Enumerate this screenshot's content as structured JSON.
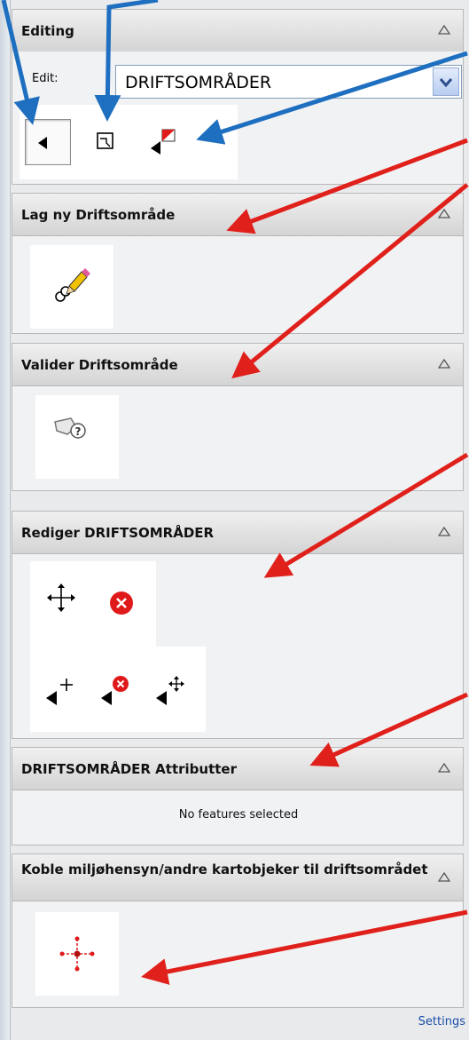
{
  "panel": {
    "title": "Editing",
    "edit_label": "Edit:",
    "layer_select": {
      "value": "DRIFTSOMRÅDER"
    },
    "edit_tools": [
      "select-tool-icon",
      "select-polygon-icon",
      "flag-select-icon"
    ]
  },
  "sections": {
    "create": {
      "title": "Lag ny Driftsområde",
      "tools": [
        "create-polygon-pencil-icon"
      ]
    },
    "validate": {
      "title": "Valider Driftsområde",
      "tools": [
        "validate-query-icon"
      ]
    },
    "edit": {
      "title": "Rediger DRIFTSOMRÅDER",
      "tools": [
        "move-icon",
        "delete-icon",
        "add-vertex-icon",
        "delete-vertex-icon",
        "move-vertex-icon"
      ]
    },
    "attributes": {
      "title": "DRIFTSOMRÅDER Attributter",
      "message": "No features selected"
    },
    "connect": {
      "title": "Koble miljøhensyn/andre kartobjeker til driftsområdet",
      "tools": [
        "connect-network-icon"
      ]
    }
  },
  "footer": {
    "settings_label": "Settings"
  },
  "colors": {
    "accent_blue": "#1f6fc0",
    "annotation_red": "#e0201b"
  }
}
